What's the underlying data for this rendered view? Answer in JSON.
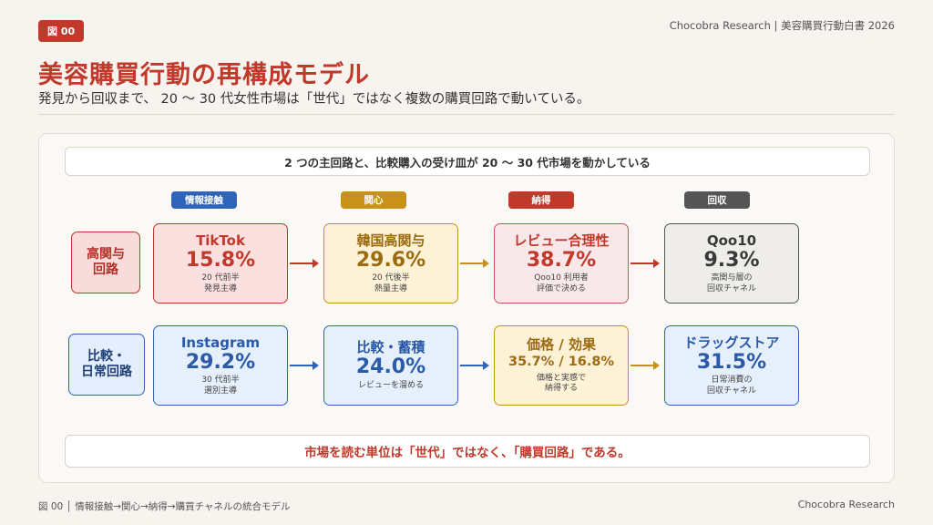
{
  "header": {
    "badge": "図 00",
    "source": "Chocobra Research | 美容購買行動白書 2026",
    "title": "美容購買行動の再構成モデル",
    "subtitle": "発見から回収まで、 20 〜 30 代女性市場は「世代」ではなく複数の購買回路で動いている。"
  },
  "panel": {
    "top_banner": "2 つの主回路と、比較購入の受け皿が 20 〜 30 代市場を動かしている",
    "bottom_banner": "市場を読む単位は「世代」ではなく、「購買回路」である。"
  },
  "stages": [
    {
      "label": "情報接触",
      "color": "#2f64b8"
    },
    {
      "label": "関心",
      "color": "#c8921a"
    },
    {
      "label": "納得",
      "color": "#c0392b"
    },
    {
      "label": "回収",
      "color": "#555555"
    }
  ],
  "rows": [
    {
      "label": "高関与\n回路",
      "nodes": [
        {
          "name": "TikTok",
          "value": "15.8%",
          "desc": "20 代前半\n発見主導"
        },
        {
          "name": "韓国高関与",
          "value": "29.6%",
          "desc": "20 代後半\n熱量主導"
        },
        {
          "name": "レビュー合理性",
          "value": "38.7%",
          "desc": "Qoo10 利用者\n評価で決める"
        },
        {
          "name": "Qoo10",
          "value": "9.3%",
          "desc": "高関与層の\n回収チャネル"
        }
      ]
    },
    {
      "label": "比較・\n日常回路",
      "nodes": [
        {
          "name": "Instagram",
          "value": "29.2%",
          "desc": "30 代前半\n選別主導"
        },
        {
          "name": "比較・蓄積",
          "value": "24.0%",
          "desc": "レビューを溜める"
        },
        {
          "name": "価格 / 効果",
          "value": "35.7% / 16.8%",
          "desc": "価格と実感で\n納得する"
        },
        {
          "name": "ドラッグストア",
          "value": "31.5%",
          "desc": "日常消費の\n回収チャネル"
        }
      ]
    }
  ],
  "colors": {
    "accent": "#c0392b",
    "red_arrow": "#c0392b",
    "amber_arrow": "#c8921a",
    "blue_arrow": "#2f64b8"
  },
  "footer": {
    "left": "図 00 │ 情報接触→関心→納得→購買チャネルの統合モデル",
    "right": "Chocobra Research"
  }
}
